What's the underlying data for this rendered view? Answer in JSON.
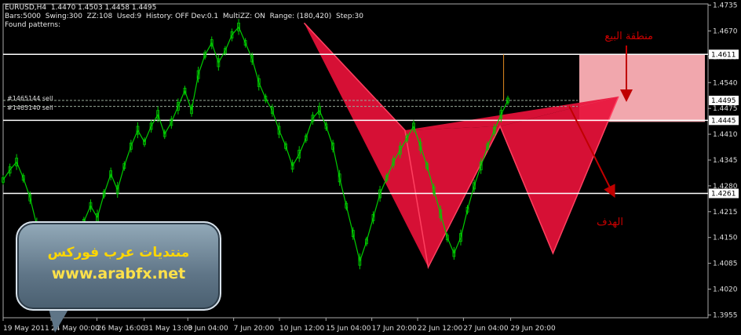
{
  "info": {
    "symbol_line": "EURUSD,H4  1.4470 1.4503 1.4458 1.4495",
    "params_line": "Bars:5000  Swing:300  ZZ:108  Used:9  History: OFF Dev:0.1  MultiZZ: ON  Range: (180,420)  Step:30",
    "found_line": "Found patterns:"
  },
  "orders": [
    "#1465144 sell",
    "#1465140 sell"
  ],
  "annotations": {
    "sell_zone": "منطقة البيع",
    "target": "الهدف"
  },
  "watermark": {
    "forum": "منتديات عرب فوركس",
    "url": "www.arabfx.net"
  },
  "colors": {
    "candle": "#00cc00",
    "pattern": "#e8113a",
    "zone": "#f1a7ad",
    "level": "#ffffff",
    "arrow": "#c00000"
  },
  "chart_data": {
    "type": "line",
    "title": "EURUSD,H4",
    "ylim": [
      1.3948,
      1.4738
    ],
    "y_ticks": [
      "1.4735",
      "1.4670",
      "1.4605",
      "1.4540",
      "1.4475",
      "1.4410",
      "1.4345",
      "1.4280",
      "1.4215",
      "1.4150",
      "1.4085",
      "1.4020",
      "1.3955"
    ],
    "x_ticks": [
      "19 May 2011",
      "24 May 00:00",
      "26 May 16:00",
      "31 May 13:00",
      "3 Jun 04:00",
      "7 Jun 20:00",
      "10 Jun 12:00",
      "15 Jun 04:00",
      "17 Jun 20:00",
      "22 Jun 12:00",
      "27 Jun 04:00",
      "29 Jun 20:00"
    ],
    "price_labels": [
      "1.4611",
      "1.4495",
      "1.4445",
      "1.4261"
    ],
    "levels": [
      1.4611,
      1.4445,
      1.4261
    ],
    "order_levels": [
      1.4495,
      1.448
    ],
    "series": [
      {
        "values": [
          1.4295,
          1.432,
          1.434,
          1.43,
          1.425,
          1.418,
          1.41,
          1.404,
          1.399,
          1.405,
          1.411,
          1.415,
          1.419,
          1.423,
          1.42,
          1.426,
          1.431,
          1.427,
          1.433,
          1.438,
          1.442,
          1.439,
          1.443,
          1.446,
          1.441,
          1.444,
          1.448,
          1.452,
          1.447,
          1.456,
          1.461,
          1.464,
          1.459,
          1.462,
          1.466,
          1.468,
          1.464,
          1.46,
          1.454,
          1.45,
          1.447,
          1.442,
          1.438,
          1.433,
          1.436,
          1.44,
          1.445,
          1.447,
          1.443,
          1.438,
          1.43,
          1.423,
          1.416,
          1.409,
          1.414,
          1.42,
          1.426,
          1.43,
          1.434,
          1.437,
          1.44,
          1.443,
          1.438,
          1.433,
          1.427,
          1.421,
          1.415,
          1.411,
          1.415,
          1.422,
          1.428,
          1.433,
          1.438,
          1.442,
          1.446,
          1.4495
        ]
      }
    ],
    "pattern_points": [
      {
        "x": 0.427,
        "y": 1.469
      },
      {
        "x": 0.57,
        "y": 1.442
      },
      {
        "x": 0.603,
        "y": 1.4075
      },
      {
        "x": 0.705,
        "y": 1.443
      },
      {
        "x": 0.78,
        "y": 1.411
      },
      {
        "x": 0.873,
        "y": 1.4505
      }
    ]
  }
}
